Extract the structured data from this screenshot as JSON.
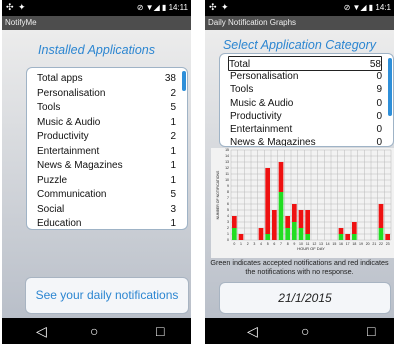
{
  "left": {
    "status_time": "14:11",
    "app_title": "NotifyMe",
    "heading": "Installed Applications",
    "apps": [
      {
        "name": "Total apps",
        "count": "38"
      },
      {
        "name": "Personalisation",
        "count": "2"
      },
      {
        "name": "Tools",
        "count": "5"
      },
      {
        "name": "Music & Audio",
        "count": "1"
      },
      {
        "name": "Productivity",
        "count": "2"
      },
      {
        "name": "Entertainment",
        "count": "1"
      },
      {
        "name": "News & Magazines",
        "count": "1"
      },
      {
        "name": "Puzzle",
        "count": "1"
      },
      {
        "name": "Communication",
        "count": "5"
      },
      {
        "name": "Social",
        "count": "3"
      },
      {
        "name": "Education",
        "count": "1"
      }
    ],
    "daily_button_label": "See your daily notifications"
  },
  "right": {
    "status_time": "14:1",
    "app_title": "Daily Notification Graphs",
    "heading": "Select Application Category",
    "categories": [
      {
        "name": "Total",
        "count": "58"
      },
      {
        "name": "Personalisation",
        "count": "0"
      },
      {
        "name": "Tools",
        "count": "9"
      },
      {
        "name": "Music & Audio",
        "count": "0"
      },
      {
        "name": "Productivity",
        "count": "0"
      },
      {
        "name": "Entertainment",
        "count": "0"
      },
      {
        "name": "News & Magazines",
        "count": "0"
      }
    ],
    "caption": "Green indicates accepted notifications and red indicates the notifications with no response.",
    "date_label": "21/1/2015"
  },
  "chart_data": {
    "type": "bar",
    "stacked": true,
    "xlabel": "HOUR OF DAY",
    "ylabel": "NUMBER OF NOTIFICATIONS",
    "ylim": [
      0,
      15
    ],
    "grid": true,
    "colors": {
      "accepted": "#22dd22",
      "no_response": "#ee1111"
    },
    "categories": [
      "0",
      "1",
      "2",
      "3",
      "4",
      "5",
      "6",
      "7",
      "8",
      "9",
      "10",
      "11",
      "12",
      "13",
      "14",
      "15",
      "16",
      "17",
      "18",
      "19",
      "20",
      "21",
      "22",
      "23"
    ],
    "series": [
      {
        "name": "accepted",
        "values": [
          2,
          0,
          0,
          0,
          0,
          1,
          0,
          8,
          2,
          3,
          2,
          1,
          0,
          0,
          0,
          0,
          1,
          0,
          1,
          0,
          0,
          0,
          2,
          0
        ]
      },
      {
        "name": "no_response",
        "values": [
          2,
          1,
          0,
          0,
          2,
          11,
          5,
          5,
          2,
          3,
          3,
          4,
          0,
          0,
          0,
          0,
          1,
          1,
          2,
          0,
          0,
          0,
          4,
          1
        ]
      }
    ]
  },
  "nav": {
    "back": "◁",
    "home": "○",
    "recents": "□"
  }
}
